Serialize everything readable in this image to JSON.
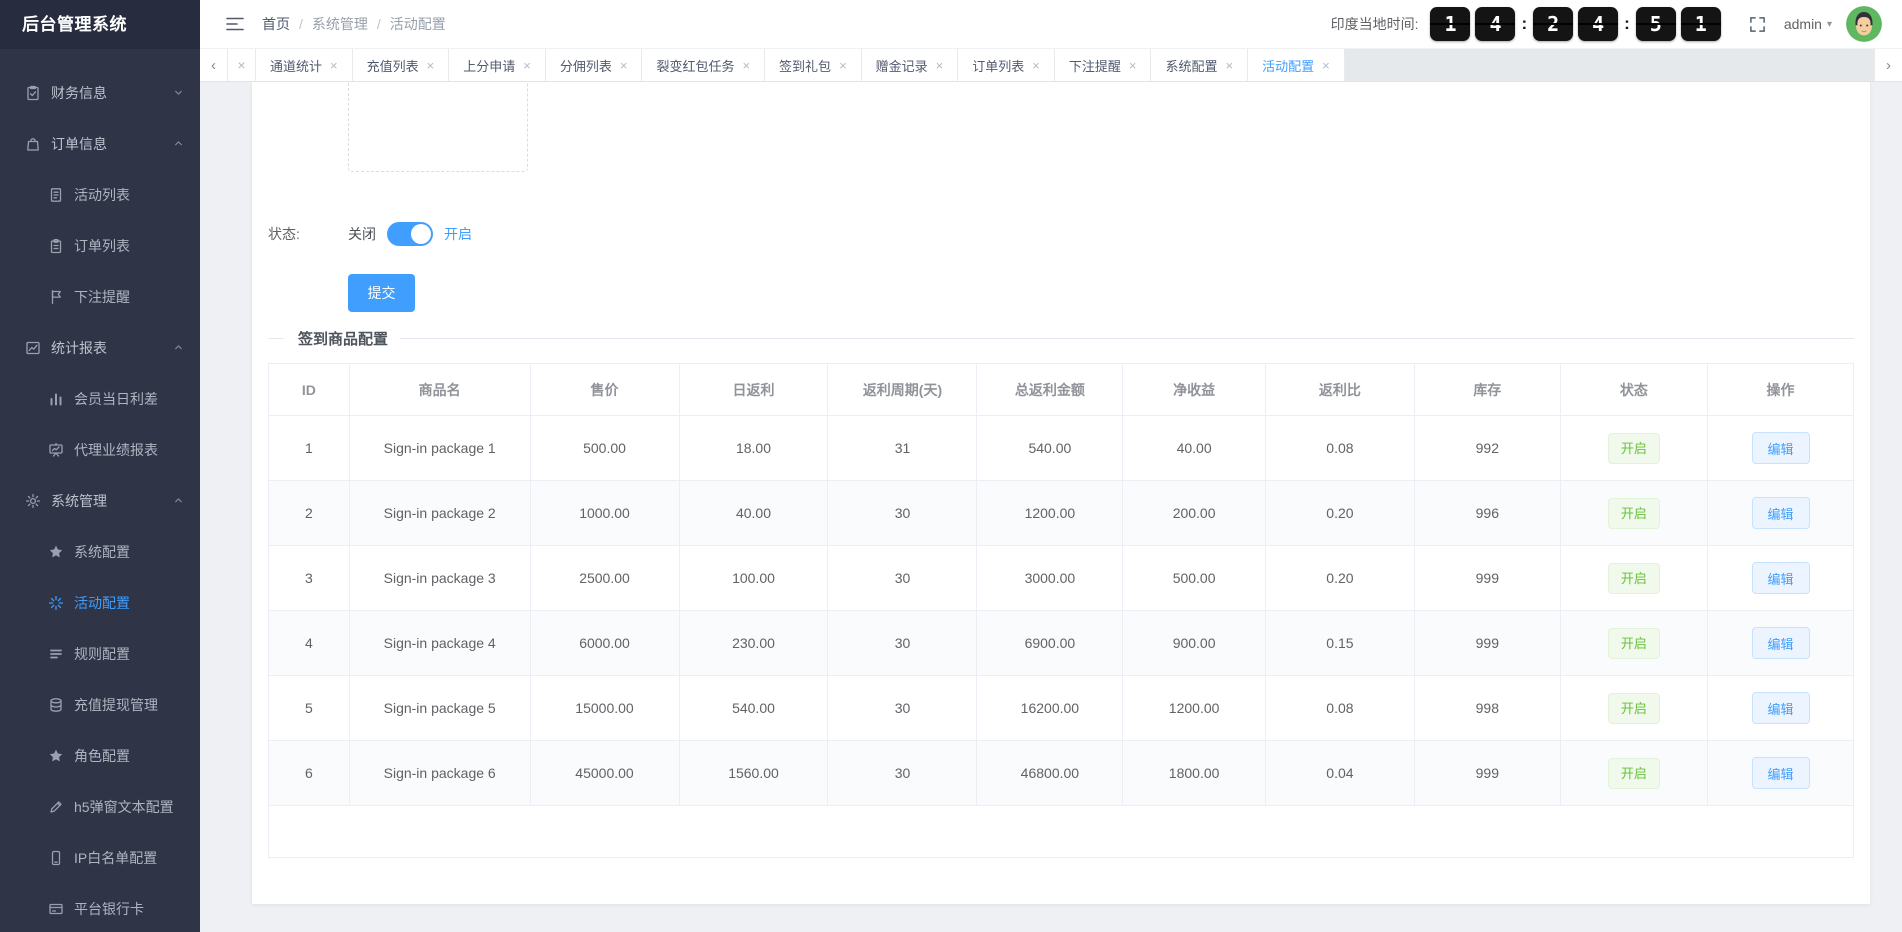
{
  "colors": {
    "accent": "#409eff",
    "success_text": "#67c23a",
    "success_bg": "#f0f9eb",
    "sidebar_bg": "#2f3447",
    "sidebar_logo_bg": "#272c3e",
    "clock_tile_bg": "#141414",
    "page_bg": "#eef0f4"
  },
  "app_title": "后台管理系统",
  "header": {
    "breadcrumb": [
      "首页",
      "系统管理",
      "活动配置"
    ],
    "breadcrumb_sep": "/",
    "time_label": "印度当地时间:",
    "clock_groups": [
      [
        "1",
        "4"
      ],
      [
        "2",
        "4"
      ],
      [
        "5",
        "1"
      ]
    ],
    "username": "admin",
    "caret": "▾"
  },
  "tabstrip": {
    "prev_glyph": "‹",
    "next_glyph": "›",
    "close_glyph": "×",
    "tabs": [
      {
        "label": "通道统计"
      },
      {
        "label": "充值列表"
      },
      {
        "label": "上分申请"
      },
      {
        "label": "分佣列表"
      },
      {
        "label": "裂变红包任务"
      },
      {
        "label": "签到礼包"
      },
      {
        "label": "赠金记录"
      },
      {
        "label": "订单列表"
      },
      {
        "label": "下注提醒"
      },
      {
        "label": "系统配置"
      },
      {
        "label": "活动配置",
        "active": true
      }
    ]
  },
  "sidebar": {
    "items": [
      {
        "id": "finance-info",
        "label": "财务信息",
        "icon": "clipboard-check-icon",
        "group": true,
        "expanded": false
      },
      {
        "id": "order-info",
        "label": "订单信息",
        "icon": "shopping-bag-icon",
        "group": true,
        "expanded": true
      },
      {
        "id": "activity-list",
        "label": "活动列表",
        "icon": "document-icon",
        "child": true
      },
      {
        "id": "order-list",
        "label": "订单列表",
        "icon": "clipboard-icon",
        "child": true
      },
      {
        "id": "bet-reminder",
        "label": "下注提醒",
        "icon": "flag-icon",
        "child": true
      },
      {
        "id": "stats-report",
        "label": "统计报表",
        "icon": "line-chart-icon",
        "group": true,
        "expanded": true
      },
      {
        "id": "member-daily-margin",
        "label": "会员当日利差",
        "icon": "bar-chart-icon",
        "child": true
      },
      {
        "id": "agent-performance",
        "label": "代理业绩报表",
        "icon": "presentation-chart-icon",
        "child": true
      },
      {
        "id": "system-management",
        "label": "系统管理",
        "icon": "gear-icon",
        "group": true,
        "expanded": true
      },
      {
        "id": "system-config",
        "label": "系统配置",
        "icon": "star-icon",
        "child": true
      },
      {
        "id": "activity-config",
        "label": "活动配置",
        "icon": "spark-icon",
        "child": true,
        "active": true
      },
      {
        "id": "rule-config",
        "label": "规则配置",
        "icon": "list-icon",
        "child": true
      },
      {
        "id": "recharge-withdraw",
        "label": "充值提现管理",
        "icon": "database-icon",
        "child": true
      },
      {
        "id": "role-config",
        "label": "角色配置",
        "icon": "star-icon",
        "child": true
      },
      {
        "id": "h5-popup-text",
        "label": "h5弹窗文本配置",
        "icon": "pencil-icon",
        "child": true
      },
      {
        "id": "ip-whitelist",
        "label": "IP白名单配置",
        "icon": "mobile-icon",
        "child": true
      },
      {
        "id": "platform-bank-card",
        "label": "平台银行卡",
        "icon": "bank-card-icon",
        "child": true
      }
    ]
  },
  "form": {
    "status_label": "状态:",
    "toggle_off": "关闭",
    "toggle_on": "开启",
    "toggle_state": "on",
    "submit_label": "提交"
  },
  "section": {
    "title": "签到商品配置"
  },
  "table": {
    "columns": [
      "ID",
      "商品名",
      "售价",
      "日返利",
      "返利周期(天)",
      "总返利金额",
      "净收益",
      "返利比",
      "库存",
      "状态",
      "操作"
    ],
    "rows": [
      {
        "cells": [
          "1",
          "Sign-in package 1",
          "500.00",
          "18.00",
          "31",
          "540.00",
          "40.00",
          "0.08",
          "992"
        ],
        "status": "开启",
        "action": "编辑"
      },
      {
        "cells": [
          "2",
          "Sign-in package 2",
          "1000.00",
          "40.00",
          "30",
          "1200.00",
          "200.00",
          "0.20",
          "996"
        ],
        "status": "开启",
        "action": "编辑"
      },
      {
        "cells": [
          "3",
          "Sign-in package 3",
          "2500.00",
          "100.00",
          "30",
          "3000.00",
          "500.00",
          "0.20",
          "999"
        ],
        "status": "开启",
        "action": "编辑"
      },
      {
        "cells": [
          "4",
          "Sign-in package 4",
          "6000.00",
          "230.00",
          "30",
          "6900.00",
          "900.00",
          "0.15",
          "999"
        ],
        "status": "开启",
        "action": "编辑"
      },
      {
        "cells": [
          "5",
          "Sign-in package 5",
          "15000.00",
          "540.00",
          "30",
          "16200.00",
          "1200.00",
          "0.08",
          "998"
        ],
        "status": "开启",
        "action": "编辑"
      },
      {
        "cells": [
          "6",
          "Sign-in package 6",
          "45000.00",
          "1560.00",
          "30",
          "46800.00",
          "1800.00",
          "0.04",
          "999"
        ],
        "status": "开启",
        "action": "编辑"
      }
    ]
  }
}
